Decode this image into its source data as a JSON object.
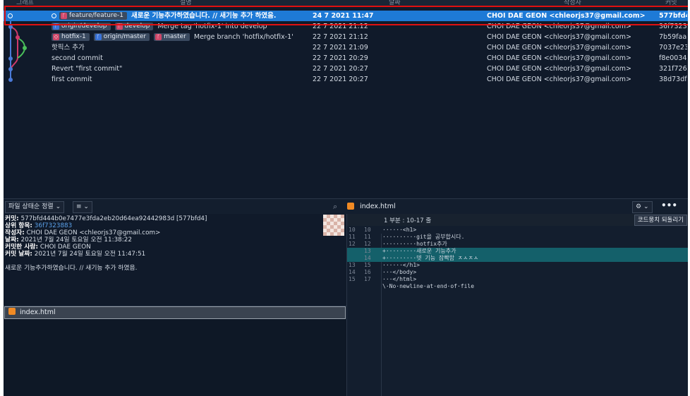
{
  "header": {
    "graph": "그래프",
    "desc": "설명",
    "date": "날짜",
    "author": "작성자",
    "commit": "커밋"
  },
  "commits": [
    {
      "refs": [
        {
          "name": "feature/feature-1",
          "icon": "branch"
        }
      ],
      "message": "새로운 기능추가하였습니다. // 새기능 추가 하였음.",
      "date": "24 7 2021 11:47",
      "author": "CHOI DAE GEON <chleorjs37@gmail.com>",
      "hash": "577bfd4",
      "selected": true
    },
    {
      "refs": [
        {
          "name": "origin/develop",
          "icon": "remote"
        },
        {
          "name": "develop",
          "icon": "branch"
        }
      ],
      "message": "Merge tag 'hotfix-1' into develop",
      "date": "22 7 2021 21:12",
      "author": "CHOI DAE GEON <chleorjs37@gmail.com>",
      "hash": "36f7323"
    },
    {
      "refs": [
        {
          "name": "hotfix-1",
          "icon": "tag"
        },
        {
          "name": "origin/master",
          "icon": "remote"
        },
        {
          "name": "master",
          "icon": "branch"
        }
      ],
      "message": "Merge branch 'hotfix/hotfix-1'",
      "date": "22 7 2021 21:12",
      "author": "CHOI DAE GEON <chleorjs37@gmail.com>",
      "hash": "7b59faa"
    },
    {
      "refs": [],
      "message": "핫픽스 추가",
      "date": "22 7 2021 21:09",
      "author": "CHOI DAE GEON <chleorjs37@gmail.com>",
      "hash": "7037e23"
    },
    {
      "refs": [],
      "message": "second commit",
      "date": "22 7 2021 20:29",
      "author": "CHOI DAE GEON <chleorjs37@gmail.com>",
      "hash": "f8e0034"
    },
    {
      "refs": [],
      "message": "Revert \"first commit\"",
      "date": "22 7 2021 20:27",
      "author": "CHOI DAE GEON <chleorjs37@gmail.com>",
      "hash": "321f726"
    },
    {
      "refs": [],
      "message": "first commit",
      "date": "22 7 2021 20:27",
      "author": "CHOI DAE GEON <chleorjs37@gmail.com>",
      "hash": "38d73df"
    }
  ],
  "toolbar": {
    "sort": "파일 상태순 정렬",
    "view": "≡",
    "file_title": "index.html"
  },
  "info": {
    "commit_label": "커밋:",
    "commit_value": "577bfd444b0e7477e3fda2eb20d64ea92442983d [577bfd4]",
    "parent_label": "상위 항목:",
    "parent_value": "36f7323883",
    "author_label": "작성자:",
    "author_value": "CHOI DAE GEON <chleorjs37@gmail.com>",
    "date_label": "날짜:",
    "date_value": "2021년 7월 24일 토요일 오전 11:38:22",
    "committer_label": "커밋한 사람:",
    "committer_value": "CHOI DAE GEON",
    "cdate_label": "커밋 날짜:",
    "cdate_value": "2021년 7월 24일 토요일 오전 11:47:51",
    "message": "새로운 기능추가하였습니다. // 새기능 추가 하였음."
  },
  "files": [
    {
      "name": "index.html"
    }
  ],
  "diff": {
    "hunk": "1 부분 : 10-17 줄",
    "revert_button": "코드뭉치 되돌리기",
    "lines": [
      {
        "old": "10",
        "new": "10",
        "text": "······<h1>",
        "type": "ctx"
      },
      {
        "old": "11",
        "new": "11",
        "text": "··········git을 공부합시다.",
        "type": "ctx"
      },
      {
        "old": "12",
        "new": "12",
        "text": "··········hotfix추가",
        "type": "ctx"
      },
      {
        "old": "",
        "new": "13",
        "text": "+·········새로운 기능추가",
        "type": "add"
      },
      {
        "old": "",
        "new": "14",
        "text": "+·········뎃 기능 잠빡함 ㅈㅅㅈㅅ",
        "type": "add"
      },
      {
        "old": "13",
        "new": "15",
        "text": "······</h1>",
        "type": "ctx"
      },
      {
        "old": "14",
        "new": "16",
        "text": "···</body>",
        "type": "ctx"
      },
      {
        "old": "15",
        "new": "17",
        "text": "···</html>",
        "type": "ctx"
      },
      {
        "old": "",
        "new": "",
        "text": "\\·No·newline·at·end·of·file",
        "type": "ctx"
      }
    ]
  },
  "colors": {
    "selected": "#1e7ad6",
    "highlight_box": "#e01010",
    "added_line": "#14606a"
  }
}
